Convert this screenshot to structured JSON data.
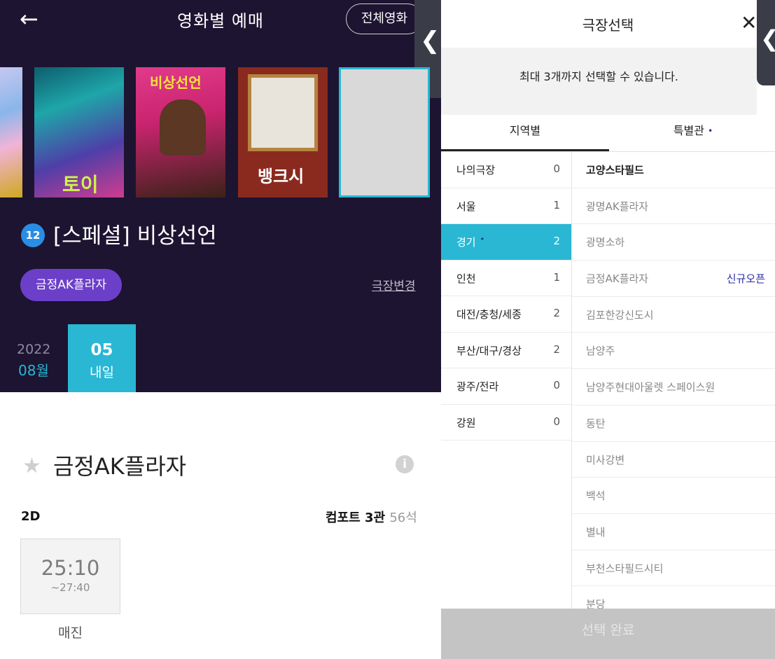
{
  "left": {
    "header": {
      "title": "영화별 예매",
      "all_movies_label": "전체영화"
    },
    "posters": [
      {
        "title": ""
      },
      {
        "title": "토이"
      },
      {
        "title": "비상선언"
      },
      {
        "title": "뱅크시"
      },
      {
        "title": ""
      }
    ],
    "movie": {
      "age": "12",
      "title": "[스페셜] 비상선언"
    },
    "theater_pill": "금정AK플라자",
    "change_theater": "극장변경",
    "date": {
      "year": "2022",
      "month": "08월",
      "day": "05",
      "day_label": "내일"
    },
    "theater_section": {
      "name": "금정AK플라자",
      "info_icon": "i",
      "format": "2D",
      "hall": "컴포트 3관",
      "seats": "56석",
      "showtime": {
        "start": "25:10",
        "end": "~27:40",
        "status": "매진"
      }
    }
  },
  "right": {
    "title": "극장선택",
    "notice": "최대 3개까지 선택할 수 있습니다.",
    "tabs": [
      {
        "label": "지역별"
      },
      {
        "label": "특별관",
        "dot": "•"
      }
    ],
    "regions": [
      {
        "name": "나의극장",
        "count": "0"
      },
      {
        "name": "서울",
        "count": "1"
      },
      {
        "name": "경기",
        "count": "2",
        "dot": "•"
      },
      {
        "name": "인천",
        "count": "1"
      },
      {
        "name": "대전/충청/세종",
        "count": "2"
      },
      {
        "name": "부산/대구/경상",
        "count": "2"
      },
      {
        "name": "광주/전라",
        "count": "0"
      },
      {
        "name": "강원",
        "count": "0"
      }
    ],
    "branches": [
      {
        "name": "고양스타필드"
      },
      {
        "name": "광명AK플라자"
      },
      {
        "name": "광명소하"
      },
      {
        "name": "금정AK플라자",
        "tag": "신규오픈"
      },
      {
        "name": "김포한강신도시"
      },
      {
        "name": "남양주"
      },
      {
        "name": "남양주현대아울렛 스페이스원"
      },
      {
        "name": "동탄"
      },
      {
        "name": "미사강변"
      },
      {
        "name": "백석"
      },
      {
        "name": "별내"
      },
      {
        "name": "부천스타필드시티"
      },
      {
        "name": "분당"
      }
    ],
    "confirm_label": "선택 완료"
  },
  "colors": {
    "accent": "#29b7d4",
    "purple": "#6c3fc8",
    "header_bg": "#1c1431",
    "tag": "#2a2aa8"
  }
}
